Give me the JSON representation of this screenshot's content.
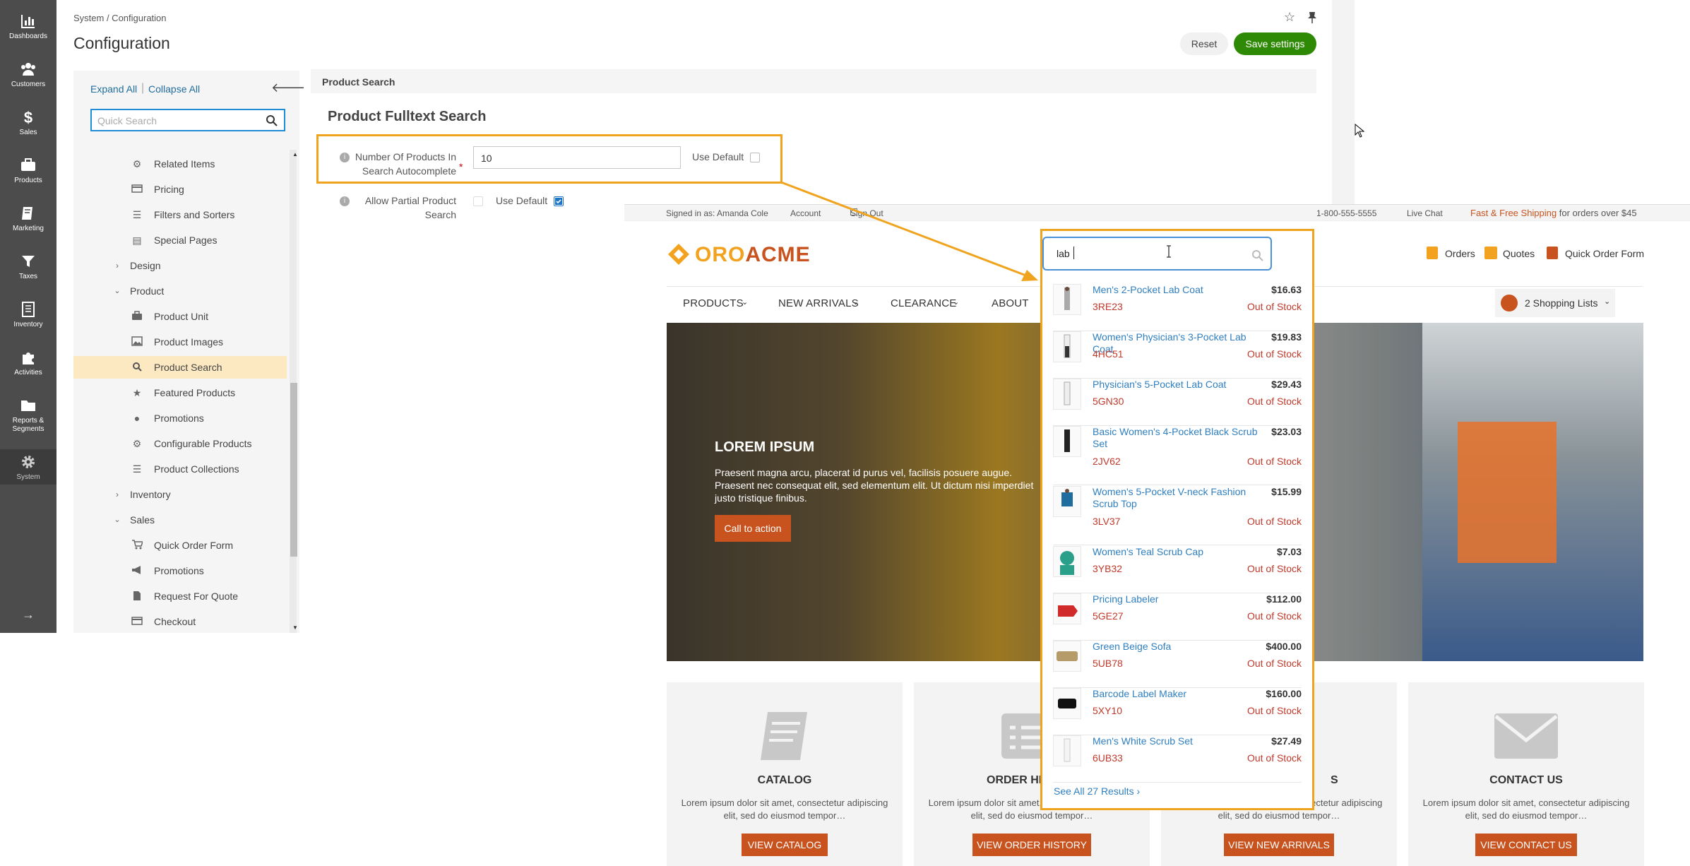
{
  "admin": {
    "nav": [
      {
        "label": "Dashboards",
        "icon": "bar-chart-icon"
      },
      {
        "label": "Customers",
        "icon": "users-icon"
      },
      {
        "label": "Sales",
        "icon": "dollar-icon"
      },
      {
        "label": "Products",
        "icon": "briefcase-icon"
      },
      {
        "label": "Marketing",
        "icon": "book-icon"
      },
      {
        "label": "Taxes",
        "icon": "filter-icon"
      },
      {
        "label": "Inventory",
        "icon": "ledger-icon"
      },
      {
        "label": "Activities",
        "icon": "puzzle-icon"
      },
      {
        "label": "Reports &",
        "label2": "Segments",
        "icon": "folder-icon"
      },
      {
        "label": "System",
        "icon": "gear-icon"
      }
    ],
    "breadcrumb": "System / Configuration",
    "title": "Configuration",
    "reset_label": "Reset",
    "save_label": "Save settings",
    "tree": {
      "expand_all": "Expand All",
      "collapse_all": "Collapse All",
      "search_placeholder": "Quick Search",
      "items": [
        {
          "label": "Related Items",
          "icon": "gear-icon"
        },
        {
          "label": "Pricing",
          "icon": "credit-card-icon"
        },
        {
          "label": "Filters and Sorters",
          "icon": "list-icon"
        },
        {
          "label": "Special Pages",
          "icon": "file-icon"
        },
        {
          "label": "Design",
          "icon": "chevron-right-icon"
        },
        {
          "label": "Product",
          "icon": "chevron-down-icon"
        },
        {
          "label": "Product Unit",
          "icon": "briefcase-icon"
        },
        {
          "label": "Product Images",
          "icon": "image-icon"
        },
        {
          "label": "Product Search",
          "icon": "search-icon"
        },
        {
          "label": "Featured Products",
          "icon": "star-icon"
        },
        {
          "label": "Promotions",
          "icon": "circle-icon"
        },
        {
          "label": "Configurable Products",
          "icon": "gear-icon"
        },
        {
          "label": "Product Collections",
          "icon": "list-icon"
        },
        {
          "label": "Inventory",
          "icon": "chevron-right-icon"
        },
        {
          "label": "Sales",
          "icon": "chevron-down-icon"
        },
        {
          "label": "Quick Order Form",
          "icon": "cart-icon"
        },
        {
          "label": "Promotions",
          "icon": "megaphone-icon"
        },
        {
          "label": "Request For Quote",
          "icon": "file-icon"
        },
        {
          "label": "Checkout",
          "icon": "credit-card-icon"
        }
      ]
    },
    "section_header": "Product Search",
    "section_title": "Product Fulltext Search",
    "field1": {
      "label_line1": "Number Of Products In",
      "label_line2": "Search Autocomplete",
      "value": "10",
      "use_default": "Use Default"
    },
    "field2": {
      "label_line1": "Allow Partial Product",
      "label_line2": "Search",
      "use_default": "Use Default"
    }
  },
  "store": {
    "signed_in": "Signed in as: Amanda Cole",
    "account": "Account",
    "sign_out": "Sign Out",
    "phone": "1-800-555-5555",
    "live_chat": "Live Chat",
    "shipping_highlight": "Fast & Free Shipping",
    "shipping_rest": "for orders over $45",
    "logo_oro": "ORO",
    "logo_acme": "ACME",
    "search_value": "lab",
    "orders": "Orders",
    "quotes": "Quotes",
    "quick_order": "Quick Order Form",
    "menu": [
      "PRODUCTS",
      "NEW ARRIVALS",
      "CLEARANCE",
      "ABOUT"
    ],
    "shopping_lists": "2 Shopping Lists",
    "hero": {
      "heading": "LOREM IPSUM",
      "text": "Praesent magna arcu, placerat id purus vel, facilisis posuere augue. Praesent nec consequat elit, sed elementum elit. Ut dictum nisi imperdiet justo tristique finibus.",
      "cta": "Call to action"
    },
    "cards": [
      {
        "title": "CATALOG",
        "text": "Lorem ipsum dolor sit amet, consectetur adipiscing elit, sed do eiusmod tempor…",
        "button": "VIEW CATALOG"
      },
      {
        "title": "ORDER HI",
        "text": "Lorem ipsum dolor sit amet, consectetur adipiscing elit, sed do eiusmod tempor…",
        "button": "VIEW ORDER HISTORY"
      },
      {
        "title": "S",
        "text": "Lorem ipsum dolor sit amet, consectetur adipiscing elit, sed do eiusmod tempor…",
        "button": "VIEW NEW ARRIVALS"
      },
      {
        "title": "CONTACT US",
        "text": "Lorem ipsum dolor sit amet, consectetur adipiscing elit, sed do eiusmod tempor…",
        "button": "VIEW CONTACT US"
      }
    ],
    "autocomplete": {
      "items": [
        {
          "name": "Men's 2-Pocket Lab Coat",
          "price": "$16.63",
          "sku": "3RE23",
          "stock": "Out of Stock"
        },
        {
          "name": "Women's Physician's 3-Pocket Lab Coat",
          "price": "$19.83",
          "sku": "4HC51",
          "stock": "Out of Stock"
        },
        {
          "name": "Physician's 5-Pocket Lab Coat",
          "price": "$29.43",
          "sku": "5GN30",
          "stock": "Out of Stock"
        },
        {
          "name": "Basic Women's 4-Pocket Black Scrub Set",
          "price": "$23.03",
          "sku": "2JV62",
          "stock": "Out of Stock"
        },
        {
          "name": "Women's 5-Pocket V-neck Fashion Scrub Top",
          "price": "$15.99",
          "sku": "3LV37",
          "stock": "Out of Stock"
        },
        {
          "name": "Women's Teal Scrub Cap",
          "price": "$7.03",
          "sku": "3YB32",
          "stock": "Out of Stock"
        },
        {
          "name": "Pricing Labeler",
          "price": "$112.00",
          "sku": "5GE27",
          "stock": "Out of Stock"
        },
        {
          "name": "Green Beige Sofa",
          "price": "$400.00",
          "sku": "5UB78",
          "stock": "Out of Stock"
        },
        {
          "name": "Barcode Label Maker",
          "price": "$160.00",
          "sku": "5XY10",
          "stock": "Out of Stock"
        },
        {
          "name": "Men's White Scrub Set",
          "price": "$27.49",
          "sku": "6UB33",
          "stock": "Out of Stock"
        }
      ],
      "see_all": "See All 27 Results"
    }
  },
  "colors": {
    "annotation": "#f0a31c",
    "save": "#2e8a04",
    "accent": "#c8531e",
    "link": "#1f6d9e"
  }
}
